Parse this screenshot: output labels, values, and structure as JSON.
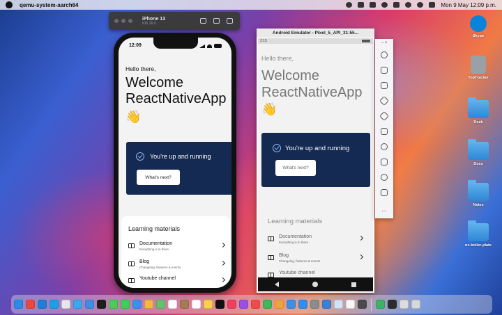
{
  "menubar": {
    "app_name": "qemu-system-aarch64",
    "datetime": "Mon 9 May  12:09 p.m."
  },
  "ios_sim": {
    "device": "iPhone 13",
    "os": "iOS 16.0",
    "status_time": "12:09",
    "greeting": "Hello there,",
    "welcome": "Welcome ReactNativeApp",
    "wave": "👋",
    "running": "You're up and running",
    "next_button": "What's next?",
    "learning_header": "Learning materials",
    "items": [
      {
        "title": "Documentation",
        "subtitle": "Everything is in there"
      },
      {
        "title": "Blog",
        "subtitle": "Changelog, features & events"
      },
      {
        "title": "Youtube channel",
        "subtitle": ""
      }
    ]
  },
  "android": {
    "window_title": "Android Emulator - Pixel_5_API_31:55...",
    "status_time": "2:15",
    "greeting": "Hello there,",
    "welcome": "Welcome ReactNativeApp",
    "wave": "👋",
    "running": "You're up and running",
    "next_button": "What's next?",
    "learning_header": "Learning materials",
    "items": [
      {
        "title": "Documentation",
        "subtitle": "Everything is in there"
      },
      {
        "title": "Blog",
        "subtitle": "Changelog, features & events"
      },
      {
        "title": "Youtube channel",
        "subtitle": ""
      }
    ],
    "side_controls": [
      "power-icon",
      "volume-up-icon",
      "volume-down-icon",
      "rotate-left-icon",
      "rotate-right-icon",
      "camera-icon",
      "zoom-icon",
      "back-icon",
      "home-icon",
      "overview-icon",
      "more-icon"
    ],
    "side_close": "×",
    "side_min": "–",
    "more": "..."
  },
  "desktop": [
    {
      "label": "Skype",
      "color": "#0a84d8"
    },
    {
      "label": "TopTracker",
      "color": "#9aa0a6"
    },
    {
      "label": "Desk",
      "color": "#3b8fdc"
    },
    {
      "label": "Docs",
      "color": "#3b8fdc"
    },
    {
      "label": "Notes",
      "color": "#3b8fdc"
    },
    {
      "label": "nx-boiler-plate",
      "color": "#3b8fdc"
    }
  ],
  "dock_apps": [
    {
      "name": "finder-icon",
      "color": "#2d8ae8"
    },
    {
      "name": "chrome-icon",
      "color": "#e9493b"
    },
    {
      "name": "vscode-icon",
      "color": "#1f7fd6"
    },
    {
      "name": "skype-icon",
      "color": "#1aa0e8"
    },
    {
      "name": "clock-icon",
      "color": "#e7e7e7"
    },
    {
      "name": "safari-icon",
      "color": "#3aa7f0"
    },
    {
      "name": "xcode-icon",
      "color": "#3c8de6"
    },
    {
      "name": "terminal-icon",
      "color": "#1e1e1e"
    },
    {
      "name": "messages-icon",
      "color": "#4ccb55"
    },
    {
      "name": "facetime-icon",
      "color": "#3ccf59"
    },
    {
      "name": "mail-icon",
      "color": "#3a8ff0"
    },
    {
      "name": "photos-icon",
      "color": "#f5b642"
    },
    {
      "name": "maps-icon",
      "color": "#61c36b"
    },
    {
      "name": "calendar-icon",
      "color": "#ffffff"
    },
    {
      "name": "contacts-icon",
      "color": "#a57b52"
    },
    {
      "name": "reminders-icon",
      "color": "#ffffff"
    },
    {
      "name": "notes-icon",
      "color": "#f5d24a"
    },
    {
      "name": "tv-icon",
      "color": "#111111"
    },
    {
      "name": "music-icon",
      "color": "#f0405e"
    },
    {
      "name": "podcasts-icon",
      "color": "#9a4fe6"
    },
    {
      "name": "news-icon",
      "color": "#f04a4a"
    },
    {
      "name": "numbers-icon",
      "color": "#3cb95a"
    },
    {
      "name": "pages-icon",
      "color": "#f0a33a"
    },
    {
      "name": "keynote-icon",
      "color": "#3a8fe8"
    },
    {
      "name": "appstore-icon",
      "color": "#2f8ef0"
    },
    {
      "name": "settings-icon",
      "color": "#8c8c8c"
    },
    {
      "name": "simulator-icon",
      "color": "#3a7fd8"
    },
    {
      "name": "preview-icon",
      "color": "#cfe3f6"
    },
    {
      "name": "textedit-icon",
      "color": "#f6f6f6"
    },
    {
      "name": "screenshot-icon",
      "color": "#4a4a4a"
    },
    {
      "name": "android-studio-icon",
      "color": "#3db36a"
    },
    {
      "name": "downloads-icon",
      "color": "#2c2c2c"
    },
    {
      "name": "documents-icon",
      "color": "#dcdcdc"
    },
    {
      "name": "trash-icon",
      "color": "#d8d8d8"
    }
  ]
}
